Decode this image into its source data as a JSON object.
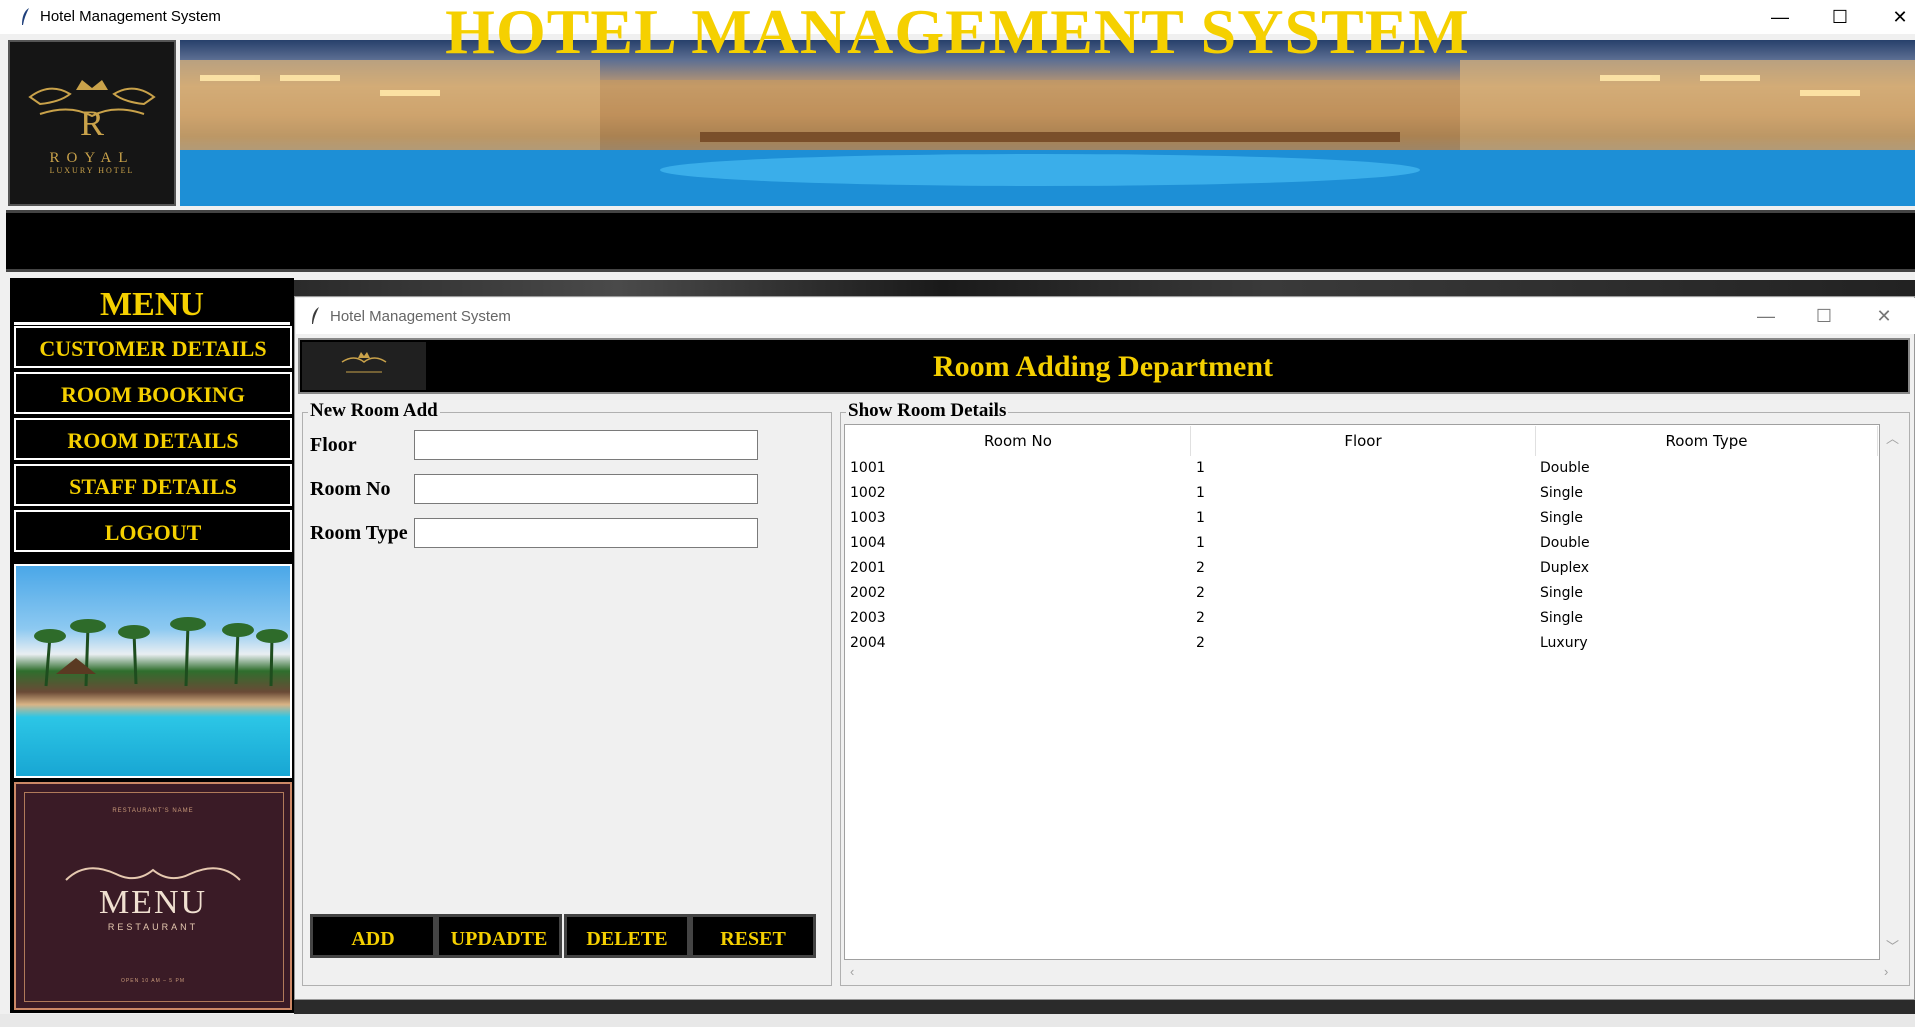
{
  "outer_window": {
    "title": "Hotel Management System",
    "minimize": "—",
    "maximize": "☐",
    "close": "✕"
  },
  "banner": {
    "logo": {
      "letter": "R",
      "name": "ROYAL",
      "tagline": "LUXURY HOTEL"
    },
    "title": "HOTEL MANAGEMENT SYSTEM"
  },
  "menu": {
    "title": "MENU",
    "items": [
      {
        "label": "CUSTOMER DETAILS"
      },
      {
        "label": "ROOM BOOKING"
      },
      {
        "label": "ROOM DETAILS"
      },
      {
        "label": "STAFF DETAILS"
      },
      {
        "label": "LOGOUT"
      }
    ],
    "restaurant_card": {
      "top_text": "RESTAURANT'S NAME",
      "title": "MENU",
      "subtitle": "RESTAURANT",
      "hours": "OPEN 10 AM – 5 PM"
    }
  },
  "inner_window": {
    "title": "Hotel Management System",
    "minimize": "—",
    "maximize": "☐",
    "close": "✕",
    "header": "Room Adding Department"
  },
  "form": {
    "frame_label": "New Room Add",
    "fields": [
      {
        "label": "Floor",
        "value": ""
      },
      {
        "label": "Room No",
        "value": ""
      },
      {
        "label": "Room Type",
        "value": ""
      }
    ],
    "buttons": {
      "add": "ADD",
      "update": "UPDADTE",
      "delete": "DELETE",
      "reset": "RESET"
    }
  },
  "details": {
    "frame_label": "Show Room Details",
    "columns": [
      "Room No",
      "Floor",
      "Room Type"
    ],
    "rows": [
      [
        "1001",
        "1",
        "Double"
      ],
      [
        "1002",
        "1",
        "Single"
      ],
      [
        "1003",
        "1",
        "Single"
      ],
      [
        "1004",
        "1",
        "Double"
      ],
      [
        "2001",
        "2",
        "Duplex"
      ],
      [
        "2002",
        "2",
        "Single"
      ],
      [
        "2003",
        "2",
        "Single"
      ],
      [
        "2004",
        "2",
        "Luxury"
      ]
    ]
  },
  "colors": {
    "accent": "#f5d000",
    "panel": "#000000",
    "window_bg": "#f0f0f0"
  },
  "icons": [
    "feather-icon",
    "minimize-icon",
    "maximize-icon",
    "close-icon",
    "scroll-up-icon",
    "scroll-down-icon",
    "scroll-left-icon",
    "scroll-right-icon"
  ]
}
